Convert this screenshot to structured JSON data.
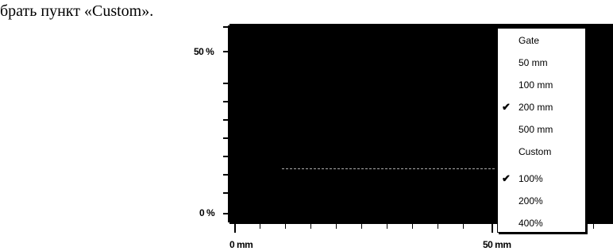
{
  "caption": "брать пункт «Custom».",
  "y_axis": {
    "top_label": "50 %",
    "bottom_label": "0 %"
  },
  "x_axis": {
    "start_label": "0 mm",
    "mid_label": "50 mm"
  },
  "menu": {
    "scale_items": [
      {
        "label": "Gate",
        "checked": false
      },
      {
        "label": "50 mm",
        "checked": false
      },
      {
        "label": "100 mm",
        "checked": false
      },
      {
        "label": "200 mm",
        "checked": true
      },
      {
        "label": "500 mm",
        "checked": false
      },
      {
        "label": "Custom",
        "checked": false
      }
    ],
    "zoom_items": [
      {
        "label": "100%",
        "checked": true
      },
      {
        "label": "200%",
        "checked": false
      },
      {
        "label": "400%",
        "checked": false
      }
    ],
    "check_glyph": "✔"
  },
  "colors": {
    "plot_background": "#000000",
    "menu_background": "#ffffff"
  }
}
